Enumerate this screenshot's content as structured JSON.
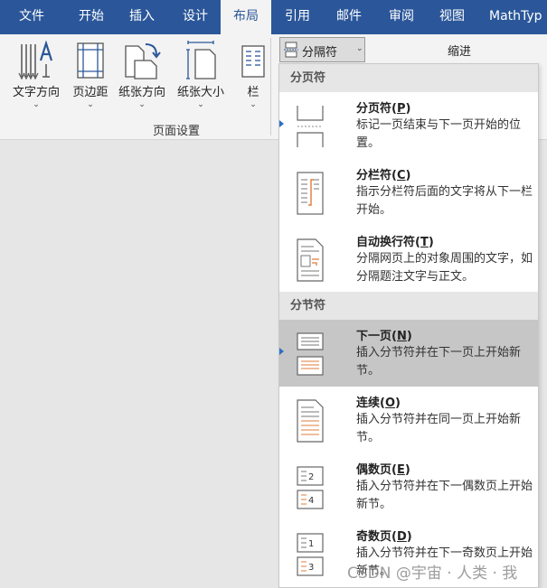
{
  "tabs": [
    {
      "label": "文件",
      "active": false
    },
    {
      "label": "开始",
      "active": false
    },
    {
      "label": "插入",
      "active": false
    },
    {
      "label": "设计",
      "active": false
    },
    {
      "label": "布局",
      "active": true
    },
    {
      "label": "引用",
      "active": false
    },
    {
      "label": "邮件",
      "active": false
    },
    {
      "label": "审阅",
      "active": false
    },
    {
      "label": "视图",
      "active": false
    },
    {
      "label": "MathTyp",
      "active": false
    }
  ],
  "ribbon": {
    "text_direction": "文字方向",
    "margins": "页边距",
    "orientation": "纸张方向",
    "size": "纸张大小",
    "columns": "栏",
    "group_label": "页面设置",
    "breaks_button": "分隔符",
    "indent": "缩进"
  },
  "menu": {
    "page_breaks_header": "分页符",
    "section_breaks_header": "分节符",
    "items": [
      {
        "title": "分页符",
        "key": "P",
        "desc": "标记一页结束与下一页开始的位置。",
        "icon": "page-break-icon"
      },
      {
        "title": "分栏符",
        "key": "C",
        "desc": "指示分栏符后面的文字将从下一栏开始。",
        "icon": "column-break-icon"
      },
      {
        "title": "自动换行符",
        "key": "T",
        "desc": "分隔网页上的对象周围的文字，如分隔题注文字与正文。",
        "icon": "text-wrapping-break-icon"
      },
      {
        "title": "下一页",
        "key": "N",
        "desc": "插入分节符并在下一页上开始新节。",
        "icon": "next-page-section-icon",
        "highlighted": true
      },
      {
        "title": "连续",
        "key": "O",
        "desc": "插入分节符并在同一页上开始新节。",
        "icon": "continuous-section-icon"
      },
      {
        "title": "偶数页",
        "key": "E",
        "desc": "插入分节符并在下一偶数页上开始新节。",
        "icon": "even-page-section-icon"
      },
      {
        "title": "奇数页",
        "key": "D",
        "desc": "插入分节符并在下一奇数页上开始新节。",
        "icon": "odd-page-section-icon"
      }
    ]
  },
  "watermark": "CSDN @宇宙 · 人类 · 我",
  "colors": {
    "tab_bar": "#2b579a",
    "ribbon": "#f3f3f3",
    "menu_hover": "#c6c6c6",
    "accent_orange": "#e07b39"
  }
}
